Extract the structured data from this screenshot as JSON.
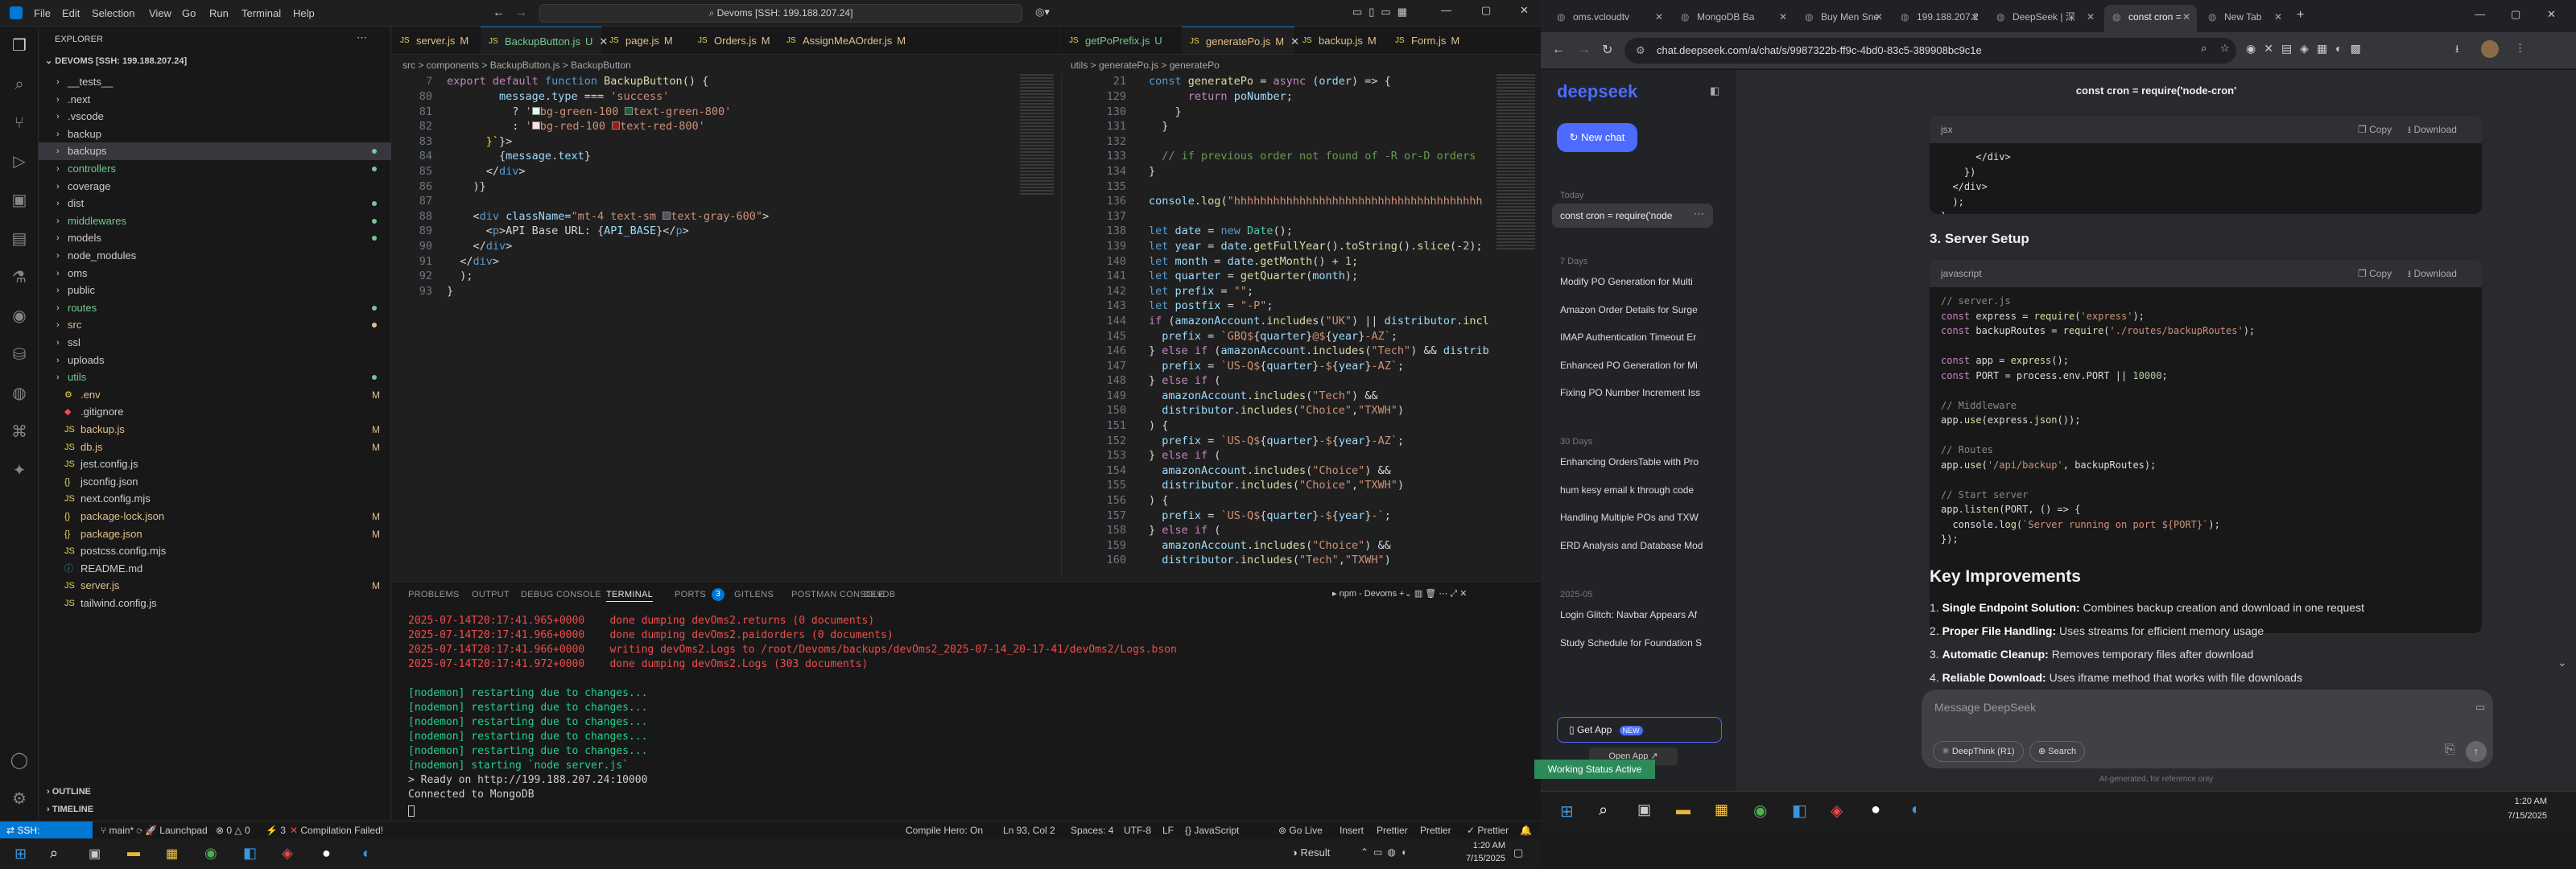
{
  "vscode": {
    "menus": [
      "File",
      "Edit",
      "Selection",
      "View",
      "Go",
      "Run",
      "Terminal",
      "Help"
    ],
    "search": "Devoms [SSH: 199.188.207.24]",
    "explorer_title": "EXPLORER",
    "root": "DEVOMS [SSH: 199.188.207.24]",
    "files": [
      {
        "n": "__tests__",
        "t": "dir"
      },
      {
        "n": ".next",
        "t": "dir"
      },
      {
        "n": ".vscode",
        "t": "dir"
      },
      {
        "n": "backup",
        "t": "dir"
      },
      {
        "n": "backups",
        "t": "dir",
        "sel": true,
        "dot": true
      },
      {
        "n": "controllers",
        "t": "dir",
        "dot": true,
        "c": "#73c991"
      },
      {
        "n": "coverage",
        "t": "dir"
      },
      {
        "n": "dist",
        "t": "dir",
        "dot": true
      },
      {
        "n": "middlewares",
        "t": "dir",
        "dot": true,
        "c": "#73c991"
      },
      {
        "n": "models",
        "t": "dir",
        "dot": true
      },
      {
        "n": "node_modules",
        "t": "dir"
      },
      {
        "n": "oms",
        "t": "dir"
      },
      {
        "n": "public",
        "t": "dir"
      },
      {
        "n": "routes",
        "t": "dir",
        "dot": true,
        "c": "#73c991"
      },
      {
        "n": "src",
        "t": "dir",
        "dot": true,
        "c": "#e2c08d"
      },
      {
        "n": "ssl",
        "t": "dir"
      },
      {
        "n": "uploads",
        "t": "dir"
      },
      {
        "n": "utils",
        "t": "dir",
        "dot": true,
        "c": "#73c991"
      },
      {
        "n": ".env",
        "t": "env",
        "b": "M",
        "c": "#e2c08d"
      },
      {
        "n": ".gitignore",
        "t": "git"
      },
      {
        "n": "backup.js",
        "t": "js",
        "b": "M",
        "c": "#e2c08d"
      },
      {
        "n": "db.js",
        "t": "js",
        "b": "M",
        "c": "#e2c08d"
      },
      {
        "n": "jest.config.js",
        "t": "js"
      },
      {
        "n": "jsconfig.json",
        "t": "json"
      },
      {
        "n": "next.config.mjs",
        "t": "js"
      },
      {
        "n": "package-lock.json",
        "t": "json",
        "b": "M",
        "c": "#e2c08d"
      },
      {
        "n": "package.json",
        "t": "json",
        "b": "M",
        "c": "#e2c08d"
      },
      {
        "n": "postcss.config.mjs",
        "t": "js"
      },
      {
        "n": "README.md",
        "t": "md"
      },
      {
        "n": "server.js",
        "t": "js",
        "b": "M",
        "c": "#e2c08d"
      },
      {
        "n": "tailwind.config.js",
        "t": "js"
      }
    ],
    "outline": "OUTLINE",
    "timeline": "TIMELINE",
    "tabs1": [
      {
        "n": "server.js",
        "s": "M"
      },
      {
        "n": "BackupButton.js",
        "s": "U",
        "active": true
      },
      {
        "n": "page.js",
        "s": "M"
      },
      {
        "n": "Orders.js",
        "s": "M"
      },
      {
        "n": "AssignMeAOrder.js",
        "s": "M"
      }
    ],
    "tabs2": [
      {
        "n": "getPoPrefix.js",
        "s": "U"
      },
      {
        "n": "generatePo.js",
        "s": "M",
        "active": true
      },
      {
        "n": "backup.js",
        "s": "M"
      },
      {
        "n": "Form.js",
        "s": "M"
      }
    ],
    "bc1": "src > components > BackupButton.js > BackupButton",
    "bc2": "utils > generatePo.js > generatePo",
    "sticky1": "export default function BackupButton() {",
    "sticky2": "const generatePo = async (order) => {",
    "panel_tabs": [
      "PROBLEMS",
      "OUTPUT",
      "DEBUG CONSOLE",
      "TERMINAL",
      "PORTS",
      "GITLENS",
      "POSTMAN CONSOLE",
      "DEVDB"
    ],
    "ports_count": "3",
    "terminal_name": "npm - Devoms",
    "terminal_lines": [
      {
        "t": "2025-07-14T20:17:41.965+0000    done dumping devOms2.returns (0 documents)",
        "c": "#f14c4c"
      },
      {
        "t": "2025-07-14T20:17:41.966+0000    done dumping devOms2.paidorders (0 documents)",
        "c": "#f14c4c"
      },
      {
        "t": "2025-07-14T20:17:41.966+0000    writing devOms2.Logs to /root/Devoms/backups/devOms2_2025-07-14_20-17-41/devOms2/Logs.bson",
        "c": "#f14c4c"
      },
      {
        "t": "2025-07-14T20:17:41.972+0000    done dumping devOms2.Logs (303 documents)",
        "c": "#f14c4c"
      },
      {
        "t": "",
        "c": "#ccc"
      },
      {
        "t": "[nodemon] restarting due to changes...",
        "c": "#23d18b"
      },
      {
        "t": "[nodemon] restarting due to changes...",
        "c": "#23d18b"
      },
      {
        "t": "[nodemon] restarting due to changes...",
        "c": "#23d18b"
      },
      {
        "t": "[nodemon] restarting due to changes...",
        "c": "#23d18b"
      },
      {
        "t": "[nodemon] restarting due to changes...",
        "c": "#23d18b"
      },
      {
        "t": "[nodemon] starting `node server.js`",
        "c": "#23d18b"
      },
      {
        "t": "> Ready on http://199.188.207.24:10000",
        "c": "#ccc"
      },
      {
        "t": "Connected to MongoDB",
        "c": "#ccc"
      }
    ],
    "status": {
      "remote": "SSH: 199.188.207.24",
      "branch": "main*",
      "launchpad": "Launchpad",
      "errors": "0",
      "warnings": "0",
      "ports": "3",
      "compile": "Compilation Failed!",
      "hero": "Compile Hero: On",
      "pos": "Ln 93, Col 2",
      "spaces": "Spaces: 4",
      "enc": "UTF-8",
      "eol": "LF",
      "lang": "JavaScript",
      "golive": "Go Live",
      "insert": "Insert",
      "prettier": "Prettier",
      "prettier2": "Prettier",
      "prettier3": "Prettier"
    },
    "taskbar": {
      "result": "Result",
      "time": "1:20 AM",
      "date": "7/15/2025"
    }
  },
  "browser": {
    "tabs": [
      "oms.vcloudtv",
      "MongoDB Ba",
      "Buy Men Sne",
      "199.188.207.2",
      "DeepSeek | 深",
      "const cron =",
      "New Tab"
    ],
    "url": "chat.deepseek.com/a/chat/s/9987322b-ff9c-4bd0-83c5-389908bc9c1e",
    "ds": {
      "logo": "deepseek",
      "new_chat": "New chat",
      "today": "Today",
      "current": "const cron = require('node",
      "g7": "7 Days",
      "g30": "30 Days",
      "gy": "2025-05",
      "h7": [
        "Modify PO Generation for Multi",
        "Amazon Order Details for Surge",
        "IMAP Authentication Timeout Er",
        "Enhanced PO Generation for Mi",
        "Fixing PO Number Increment Iss"
      ],
      "h30": [
        "Enhancing OrdersTable with Pro",
        "hum kesy email k through code",
        "Handling Multiple POs and TXW",
        "ERD Analysis and Database Mod"
      ],
      "hy": [
        "Login Glitch: Navbar Appears Af",
        "Study Schedule for Foundation S"
      ],
      "get_app": "Get App",
      "new_badge": "NEW",
      "open_app": "Open App ↗",
      "chat_title": "const cron = require('node-cron'",
      "block1_lang": "jsx",
      "copy": "Copy",
      "download": "Download",
      "block1_code": "      </div>\n    })\n  </div>\n  );\n}",
      "h_server": "3. Server Setup",
      "block2_lang": "javascript",
      "h_key": "Key Improvements",
      "improvements": [
        {
          "b": "Single Endpoint Solution:",
          "t": " Combines backup creation and download in one request"
        },
        {
          "b": "Proper File Handling:",
          "t": " Uses streams for efficient memory usage"
        },
        {
          "b": "Automatic Cleanup:",
          "t": " Removes temporary files after download"
        },
        {
          "b": "Reliable Download:",
          "t": " Uses iframe method that works with file downloads"
        }
      ],
      "input_ph": "Message DeepSeek",
      "deepthink": "DeepThink (R1)",
      "search": "Search",
      "footer": "AI-generated, for reference only"
    },
    "working": "Working Status Active",
    "time": "1:20 AM",
    "date": "7/15/2025"
  }
}
